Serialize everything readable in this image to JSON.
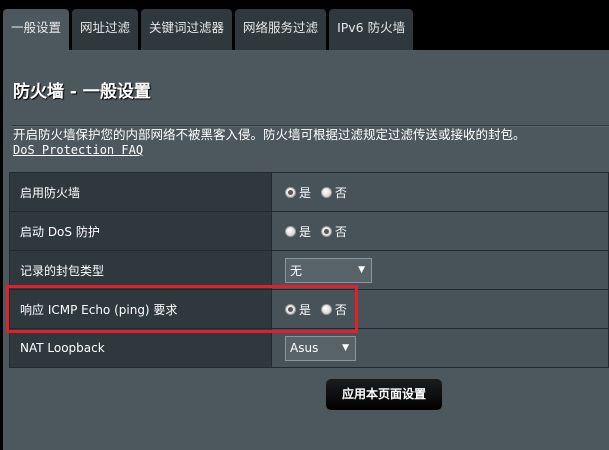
{
  "tabs": [
    "一般设置",
    "网址过滤",
    "关键词过滤器",
    "网络服务过滤",
    "IPv6 防火墙"
  ],
  "title": "防火墙 - 一般设置",
  "description": "开启防火墙保护您的内部网络不被黑客入侵。防火墙可根据过滤规定过滤传送或接收的封包。",
  "faq_link": "DoS Protection FAQ",
  "yes": "是",
  "no": "否",
  "rows": [
    {
      "label": "启用防火墙",
      "value": "是"
    },
    {
      "label": "启动 DoS 防护",
      "value": "否"
    },
    {
      "label": "记录的封包类型",
      "value": "无"
    },
    {
      "label": "响应 ICMP Echo (ping) 要求",
      "value": "是"
    },
    {
      "label": "NAT Loopback",
      "value": "Asus"
    }
  ],
  "apply_button": "应用本页面设置",
  "highlight_color": "#e0202a"
}
